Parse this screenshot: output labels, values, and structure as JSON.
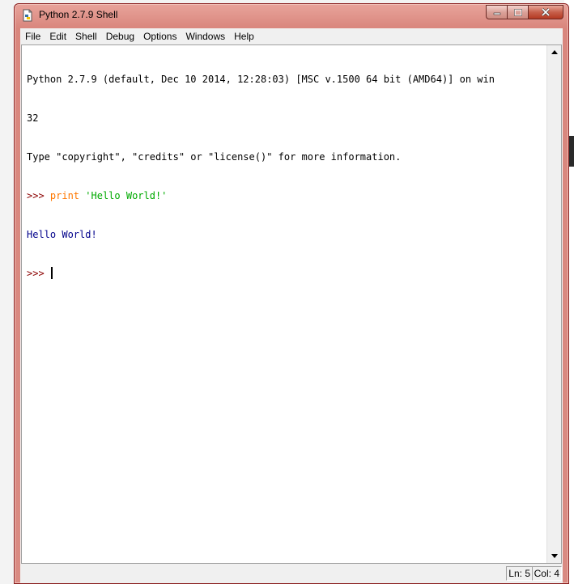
{
  "window": {
    "title": "Python 2.7.9 Shell",
    "icon": "python-file-icon"
  },
  "controls": {
    "minimize": "minimize-icon",
    "maximize": "maximize-icon",
    "close": "close-icon"
  },
  "menu": {
    "items": [
      "File",
      "Edit",
      "Shell",
      "Debug",
      "Options",
      "Windows",
      "Help"
    ]
  },
  "shell": {
    "banner_line1": "Python 2.7.9 (default, Dec 10 2014, 12:28:03) [MSC v.1500 64 bit (AMD64)] on win",
    "banner_line2": "32",
    "banner_line3": "Type \"copyright\", \"credits\" or \"license()\" for more information.",
    "prompt": ">>> ",
    "cmd_keyword": "print",
    "cmd_string": "'Hello World!'",
    "output": "Hello World!",
    "prompt2": ">>> "
  },
  "status": {
    "ln": "Ln: 5",
    "col": "Col: 4"
  },
  "colors": {
    "prompt": "#8b0000",
    "keyword": "#ff7700",
    "string": "#00aa00",
    "output": "#00008b"
  }
}
